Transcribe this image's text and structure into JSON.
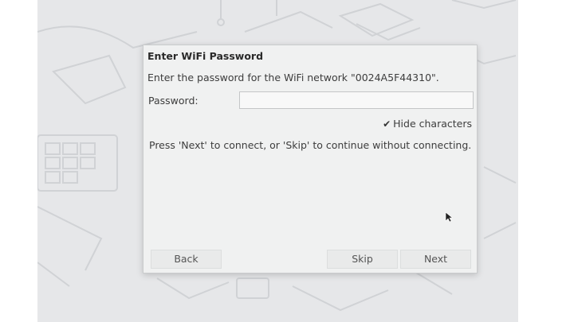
{
  "dialog": {
    "title": "Enter WiFi Password",
    "description": "Enter the password for the WiFi network \"0024A5F44310\".",
    "password_label": "Password:",
    "password_value": "",
    "hide_characters_label": "Hide characters",
    "hide_characters_checked": true,
    "instructions": "Press 'Next' to connect, or 'Skip' to continue without connecting.",
    "buttons": {
      "back": "Back",
      "skip": "Skip",
      "next": "Next"
    }
  },
  "icons": {
    "checkbox": "check-icon",
    "pointer": "mouse-pointer-icon"
  }
}
